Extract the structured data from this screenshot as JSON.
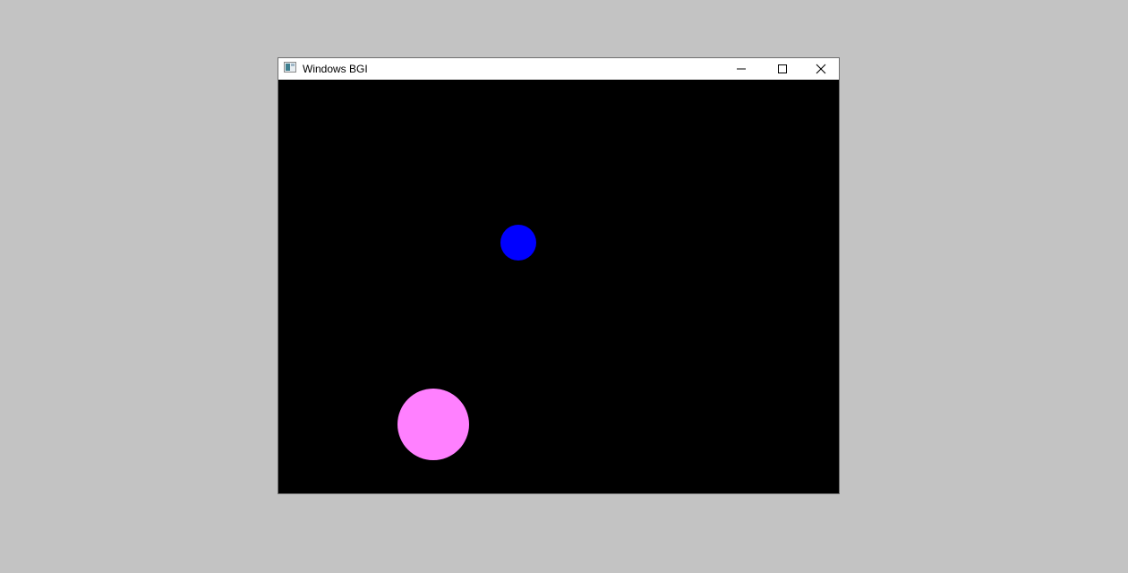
{
  "window": {
    "title": "Windows BGI",
    "app_icon": "app-window-icon",
    "controls": {
      "minimize_icon": "minimize-icon",
      "maximize_icon": "maximize-icon",
      "close_icon": "close-icon"
    }
  },
  "canvas": {
    "background_color": "#000000",
    "shapes": [
      {
        "type": "circle",
        "color": "#0000ff"
      },
      {
        "type": "circle",
        "color": "#ff80ff"
      }
    ]
  },
  "desktop": {
    "background_color": "#c3c3c3"
  }
}
